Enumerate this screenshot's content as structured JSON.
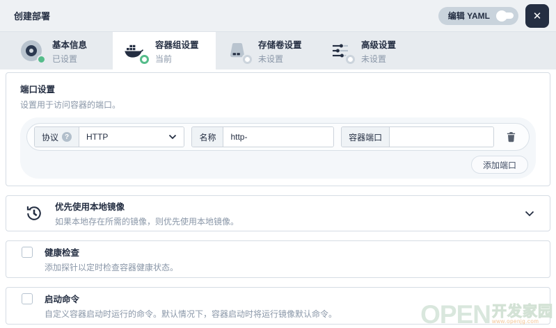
{
  "header": {
    "title": "创建部署",
    "edit_yaml_label": "编辑 YAML",
    "close_glyph": "✕"
  },
  "tabs": [
    {
      "label": "基本信息",
      "status": "已设置",
      "state": "done"
    },
    {
      "label": "容器组设置",
      "status": "当前",
      "state": "current"
    },
    {
      "label": "存储卷设置",
      "status": "未设置",
      "state": "unset"
    },
    {
      "label": "高级设置",
      "status": "未设置",
      "state": "unset"
    }
  ],
  "port_section": {
    "title": "端口设置",
    "description": "设置用于访问容器的端口。",
    "row": {
      "protocol_label": "协议",
      "protocol_help": "?",
      "protocol_value": "HTTP",
      "name_label": "名称",
      "name_value": "http-",
      "port_label": "容器端口",
      "port_value": ""
    },
    "add_button": "添加端口"
  },
  "local_image_card": {
    "title": "优先使用本地镜像",
    "description": "如果本地存在所需的镜像，则优先使用本地镜像。"
  },
  "health_card": {
    "title": "健康检查",
    "description": "添加探针以定时检查容器健康状态。"
  },
  "command_card": {
    "title": "启动命令",
    "description": "自定义容器启动时运行的命令。默认情况下，容器启动时将运行镜像默认命令。"
  },
  "watermark": {
    "brand": "OPEN",
    "brand_cn": "开发家园",
    "url": "www.openjg.com"
  },
  "colors": {
    "accent_green": "#55bc8a",
    "dark": "#242e42",
    "border": "#ccd3db",
    "panel_gray": "#f4f7fa"
  }
}
